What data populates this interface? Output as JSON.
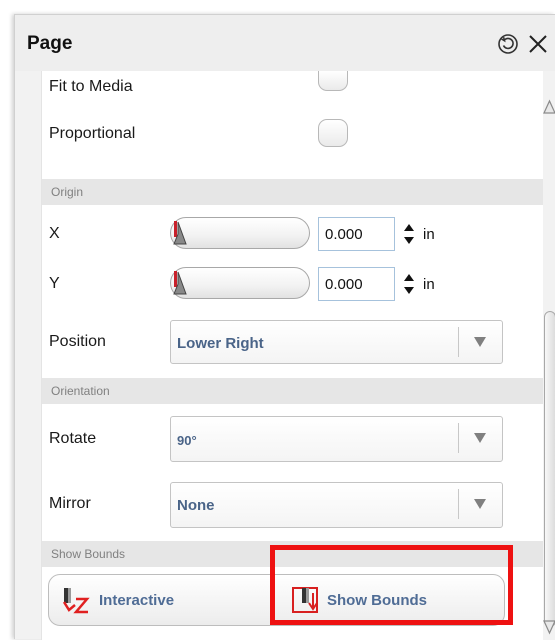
{
  "panel": {
    "title": "Page"
  },
  "titlebar": {
    "icons": [
      "reset-icon",
      "close-icon"
    ]
  },
  "rows": {
    "fit_to_media": {
      "label": "Fit to Media"
    },
    "proportional": {
      "label": "Proportional"
    }
  },
  "sections": {
    "origin": "Origin",
    "orientation": "Orientation",
    "show_bounds": "Show Bounds"
  },
  "origin": {
    "x": {
      "label": "X",
      "value": "0.000",
      "unit": "in"
    },
    "y": {
      "label": "Y",
      "value": "0.000",
      "unit": "in"
    },
    "position": {
      "label": "Position",
      "value": "Lower Right"
    }
  },
  "orientation": {
    "rotate": {
      "label": "Rotate",
      "value": "90°"
    },
    "mirror": {
      "label": "Mirror",
      "value": "None"
    }
  },
  "bounds_buttons": {
    "interactive": {
      "label": "Interactive",
      "icon": "interactive-icon"
    },
    "show_bounds": {
      "label": "Show Bounds",
      "icon": "show-bounds-icon"
    }
  },
  "colors": {
    "highlight": "#ee1111",
    "value_text": "#4a6488",
    "button_text": "#4f6c95",
    "section_bg": "#e6e6e6"
  }
}
